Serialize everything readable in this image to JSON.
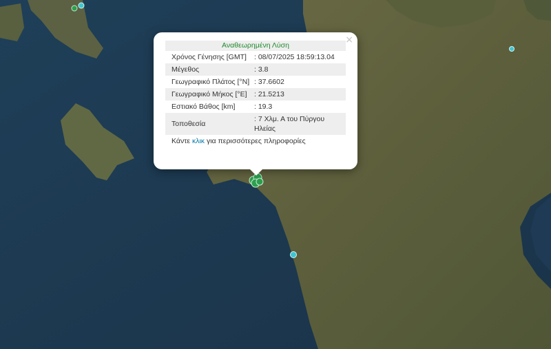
{
  "popup": {
    "title": "Αναθεωρημένη Λύση",
    "rows": [
      {
        "label": "Χρόνος Γένησης [GMT]",
        "value": ": 08/07/2025 18:59:13.04"
      },
      {
        "label": "Μέγεθος",
        "value": ": 3.8"
      },
      {
        "label": "Γεωγραφικό Πλάτος [°N]",
        "value": ": 37.6602"
      },
      {
        "label": "Γεωγραφικό Μήκος [°E]",
        "value": ": 21.5213"
      },
      {
        "label": "Εστιακό Βάθος [km]",
        "value": ": 19.3"
      },
      {
        "label": "Τοποθεσία",
        "value": ": 7 Χλμ. Α του Πύργου Ηλείας"
      }
    ],
    "more_prefix": "Κάντε ",
    "more_link": "κλικ",
    "more_suffix": " για περισσότερες πληροφορίες",
    "close_symbol": "×"
  },
  "colors": {
    "sea": "#1d3a52",
    "land": "#5f6442",
    "marker_green": "#2e9e4f",
    "marker_cyan": "#3ec6d0",
    "title_green": "#1f8a2c",
    "link": "#0078a8"
  }
}
